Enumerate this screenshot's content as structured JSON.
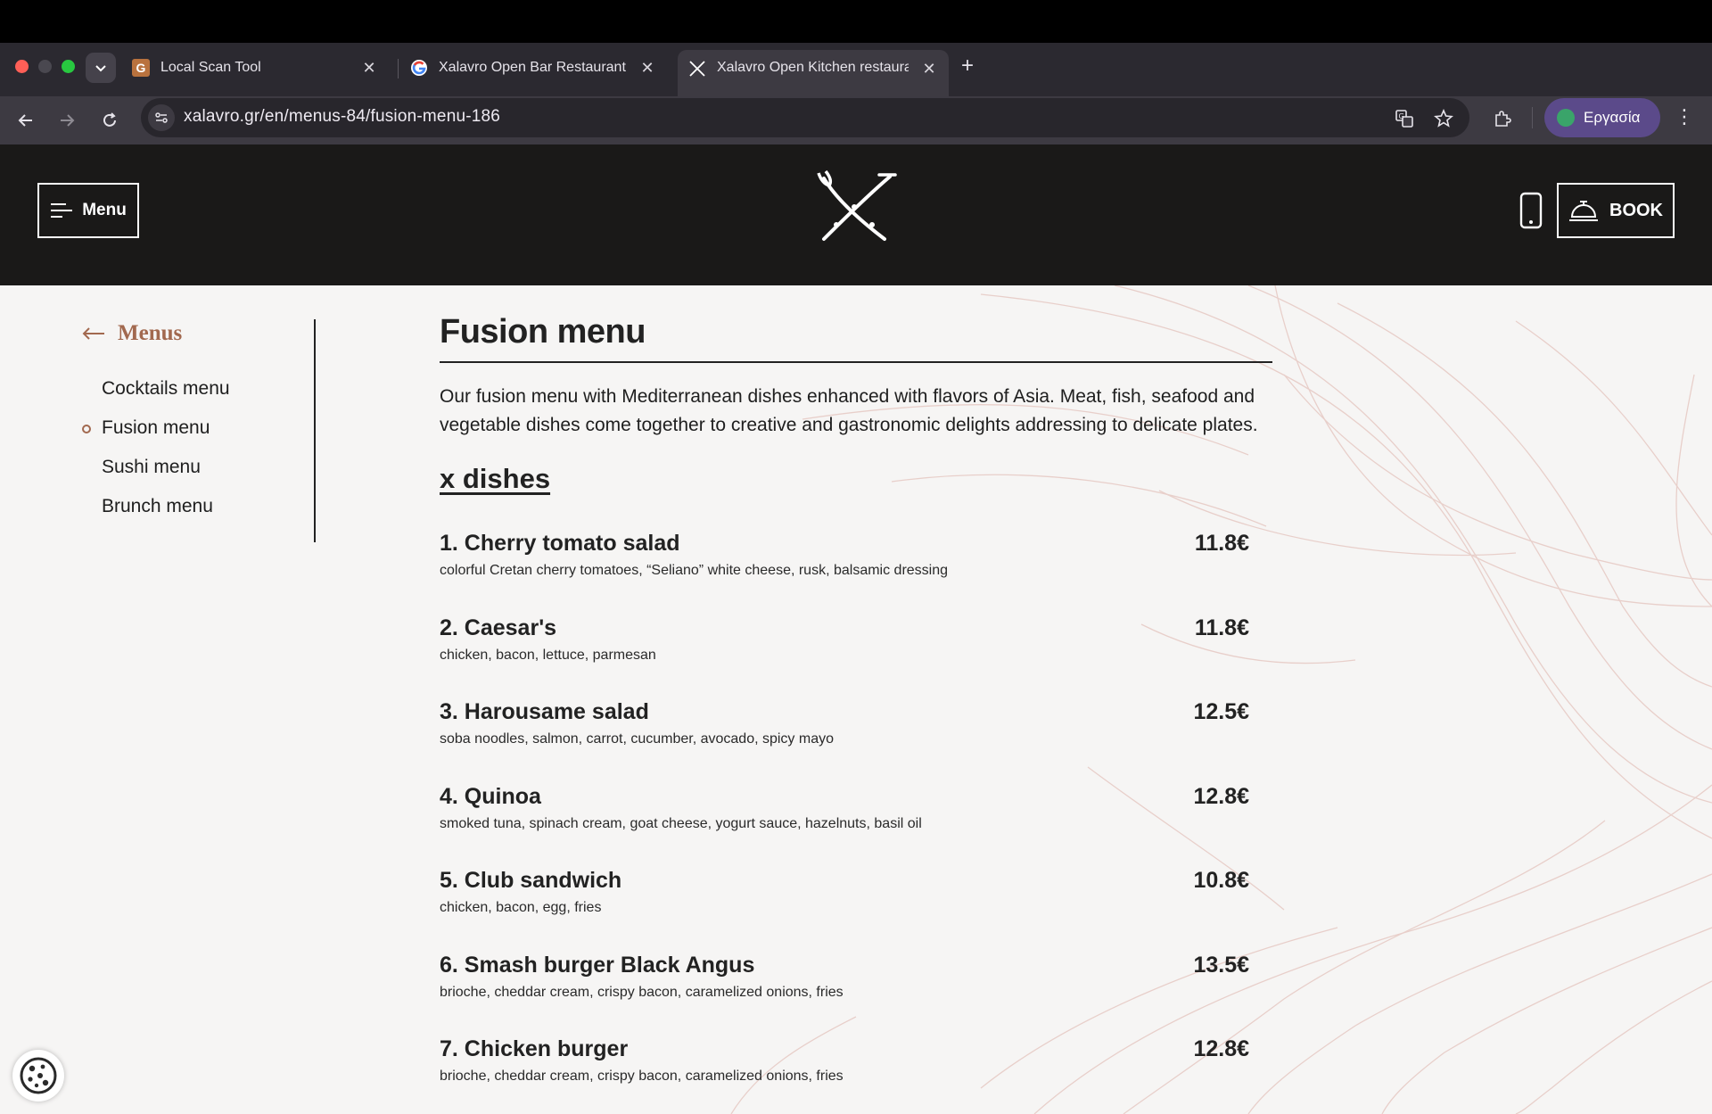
{
  "browser": {
    "tabs": [
      {
        "title": "Local Scan Tool",
        "favicon": "G"
      },
      {
        "title": "Xalavro Open Bar Restaurant",
        "favicon": "google-icon"
      },
      {
        "title": "Xalavro Open Kitchen restaurant",
        "favicon": "xalavro-icon",
        "active": true
      }
    ],
    "url": "xalavro.gr/en/menus-84/fusion-menu-186",
    "profile_label": "Εργασία"
  },
  "header": {
    "menu_label": "Menu",
    "book_label": "BOOK"
  },
  "sidebar": {
    "back_label": "Menus",
    "items": [
      {
        "label": "Cocktails menu",
        "active": false
      },
      {
        "label": "Fusion menu",
        "active": true
      },
      {
        "label": "Sushi menu",
        "active": false
      },
      {
        "label": "Brunch menu",
        "active": false
      }
    ]
  },
  "main": {
    "title": "Fusion menu",
    "intro": "Our fusion menu with Mediterranean dishes enhanced with flavors of Asia. Meat, fish, seafood and vegetable dishes come together to creative and gastronomic delights addressing to delicate plates.",
    "section_title": "x dishes",
    "dishes": [
      {
        "name": "1. Cherry tomato salad",
        "price": "11.8€",
        "desc": "colorful Cretan cherry tomatoes, “Seliano” white cheese, rusk, balsamic dressing"
      },
      {
        "name": "2. Caesar's",
        "price": "11.8€",
        "desc": "chicken, bacon, lettuce, parmesan"
      },
      {
        "name": "3. Harousame salad",
        "price": "12.5€",
        "desc": "soba noodles, salmon, carrot, cucumber, avocado, spicy mayo"
      },
      {
        "name": "4. Quinoa",
        "price": "12.8€",
        "desc": "smoked tuna, spinach cream, goat cheese, yogurt sauce, hazelnuts, basil oil"
      },
      {
        "name": "5. Club sandwich",
        "price": "10.8€",
        "desc": "chicken, bacon, egg, fries"
      },
      {
        "name": "6. Smash burger Black Angus",
        "price": "13.5€",
        "desc": "brioche, cheddar cream, crispy bacon, caramelized onions, fries"
      },
      {
        "name": "7. Chicken burger",
        "price": "12.8€",
        "desc": "brioche, cheddar cream, crispy bacon, caramelized onions, fries"
      }
    ]
  },
  "colors": {
    "accent": "#a2694f",
    "header_bg": "#1a1918",
    "page_bg": "#f6f5f4"
  }
}
